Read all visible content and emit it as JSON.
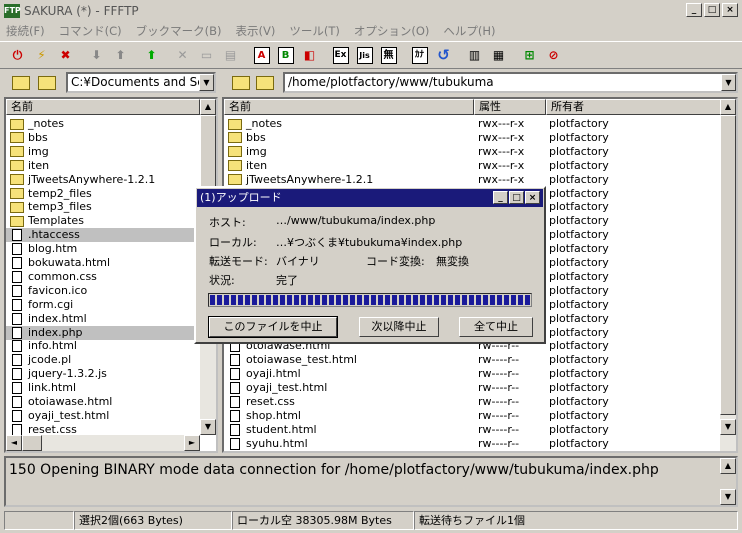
{
  "window": {
    "app_icon_label": "FTP",
    "title": "SAKURA (*) - FFFTP",
    "minimize": "_",
    "maximize": "□",
    "close": "×"
  },
  "menu": [
    "接続(F)",
    "コマンド(C)",
    "ブックマーク(B)",
    "表示(V)",
    "ツール(T)",
    "オプション(O)",
    "ヘルプ(H)"
  ],
  "toolbar": {
    "buttons": [
      "connect-icon",
      "quick-connect-icon",
      "disconnect-icon",
      "download-icon",
      "upload-icon",
      "mirror-upload-icon",
      "delete-icon",
      "rename-icon",
      "mkdir-icon",
      "ascii-mode-icon",
      "binary-mode-icon",
      "auto-mode-icon",
      "ext-mode-icon",
      "jis-mode-icon",
      "no-convert-icon",
      "kana-icon",
      "refresh-icon",
      "list-view-icon",
      "detail-view-icon",
      "tree-icon",
      "stop-icon"
    ],
    "labels": {
      "ascii": "A",
      "binary": "B",
      "ext": "Ex",
      "jis": "Jis",
      "none": "無",
      "kana": "ｶﾅ"
    }
  },
  "local": {
    "path": "C:¥Documents and Se",
    "header_name": "名前",
    "files": [
      {
        "name": "_notes",
        "type": "folder",
        "selected": false
      },
      {
        "name": "bbs",
        "type": "folder",
        "selected": false
      },
      {
        "name": "img",
        "type": "folder",
        "selected": false
      },
      {
        "name": "iten",
        "type": "folder",
        "selected": false
      },
      {
        "name": "jTweetsAnywhere-1.2.1",
        "type": "folder",
        "selected": false
      },
      {
        "name": "temp2_files",
        "type": "folder",
        "selected": false
      },
      {
        "name": "temp3_files",
        "type": "folder",
        "selected": false
      },
      {
        "name": "Templates",
        "type": "folder",
        "selected": false
      },
      {
        "name": ".htaccess",
        "type": "file",
        "selected": true
      },
      {
        "name": "blog.htm",
        "type": "file",
        "selected": false
      },
      {
        "name": "bokuwata.html",
        "type": "file",
        "selected": false
      },
      {
        "name": "common.css",
        "type": "file",
        "selected": false
      },
      {
        "name": "favicon.ico",
        "type": "file",
        "selected": false
      },
      {
        "name": "form.cgi",
        "type": "file",
        "selected": false
      },
      {
        "name": "index.html",
        "type": "file",
        "selected": false
      },
      {
        "name": "index.php",
        "type": "file",
        "selected": true
      },
      {
        "name": "info.html",
        "type": "file",
        "selected": false
      },
      {
        "name": "jcode.pl",
        "type": "file",
        "selected": false
      },
      {
        "name": "jquery-1.3.2.js",
        "type": "file",
        "selected": false
      },
      {
        "name": "link.html",
        "type": "file",
        "selected": false
      },
      {
        "name": "otoiawase.html",
        "type": "file",
        "selected": false
      },
      {
        "name": "oyaji_test.html",
        "type": "file",
        "selected": false
      },
      {
        "name": "reset.css",
        "type": "file",
        "selected": false
      }
    ]
  },
  "remote": {
    "path": "/home/plotfactory/www/tubukuma",
    "headers": {
      "name": "名前",
      "attr": "属性",
      "owner": "所有者"
    },
    "files": [
      {
        "name": "_notes",
        "type": "folder",
        "attr": "rwx---r-x",
        "owner": "plotfactory"
      },
      {
        "name": "bbs",
        "type": "folder",
        "attr": "rwx---r-x",
        "owner": "plotfactory"
      },
      {
        "name": "img",
        "type": "folder",
        "attr": "rwx---r-x",
        "owner": "plotfactory"
      },
      {
        "name": "iten",
        "type": "folder",
        "attr": "rwx---r-x",
        "owner": "plotfactory"
      },
      {
        "name": "jTweetsAnywhere-1.2.1",
        "type": "folder",
        "attr": "rwx---r-x",
        "owner": "plotfactory"
      },
      {
        "name": "",
        "type": "folder",
        "attr": "",
        "owner": "plotfactory"
      },
      {
        "name": "",
        "type": "folder",
        "attr": "",
        "owner": "plotfactory"
      },
      {
        "name": "",
        "type": "folder",
        "attr": "",
        "owner": "plotfactory"
      },
      {
        "name": "",
        "type": "file",
        "attr": "",
        "owner": "plotfactory"
      },
      {
        "name": "",
        "type": "file",
        "attr": "",
        "owner": "plotfactory"
      },
      {
        "name": "",
        "type": "file",
        "attr": "",
        "owner": "plotfactory"
      },
      {
        "name": "",
        "type": "file",
        "attr": "",
        "owner": "plotfactory"
      },
      {
        "name": "",
        "type": "file",
        "attr": "",
        "owner": "plotfactory"
      },
      {
        "name": "",
        "type": "file",
        "attr": "",
        "owner": "plotfactory"
      },
      {
        "name": "",
        "type": "file",
        "attr": "",
        "owner": "plotfactory"
      },
      {
        "name": "",
        "type": "file",
        "attr": "",
        "owner": "plotfactory"
      },
      {
        "name": "otoiawase.html",
        "type": "file",
        "attr": "rw----r--",
        "owner": "plotfactory"
      },
      {
        "name": "otoiawase_test.html",
        "type": "file",
        "attr": "rw----r--",
        "owner": "plotfactory"
      },
      {
        "name": "oyaji.html",
        "type": "file",
        "attr": "rw----r--",
        "owner": "plotfactory"
      },
      {
        "name": "oyaji_test.html",
        "type": "file",
        "attr": "rw----r--",
        "owner": "plotfactory"
      },
      {
        "name": "reset.css",
        "type": "file",
        "attr": "rw----r--",
        "owner": "plotfactory"
      },
      {
        "name": "shop.html",
        "type": "file",
        "attr": "rw----r--",
        "owner": "plotfactory"
      },
      {
        "name": "student.html",
        "type": "file",
        "attr": "rw----r--",
        "owner": "plotfactory"
      },
      {
        "name": "syuhu.html",
        "type": "file",
        "attr": "rw----r--",
        "owner": "plotfactory"
      }
    ]
  },
  "dialog": {
    "title": "(1)アップロード",
    "host_label": "ホスト:",
    "host_value": "…/www/tubukuma/index.php",
    "local_label": "ローカル:",
    "local_value": "…¥つぶくま¥tubukuma¥index.php",
    "mode_label": "転送モード:",
    "mode_value": "バイナリ",
    "conv_label": "コード変換:",
    "conv_value": "無変換",
    "status_label": "状況:",
    "status_value": "完了",
    "progress": 1.0,
    "btn_abort_file": "このファイルを中止",
    "btn_abort_next": "次以降中止",
    "btn_abort_all": "全て中止"
  },
  "log": {
    "text": "150 Opening BINARY mode data connection for /home/plotfactory/www/tubukuma/index.php"
  },
  "status": {
    "selection": "選択2個(663 Bytes)",
    "local_free": "ローカル空 38305.98M Bytes",
    "queue": "転送待ちファイル1個"
  }
}
